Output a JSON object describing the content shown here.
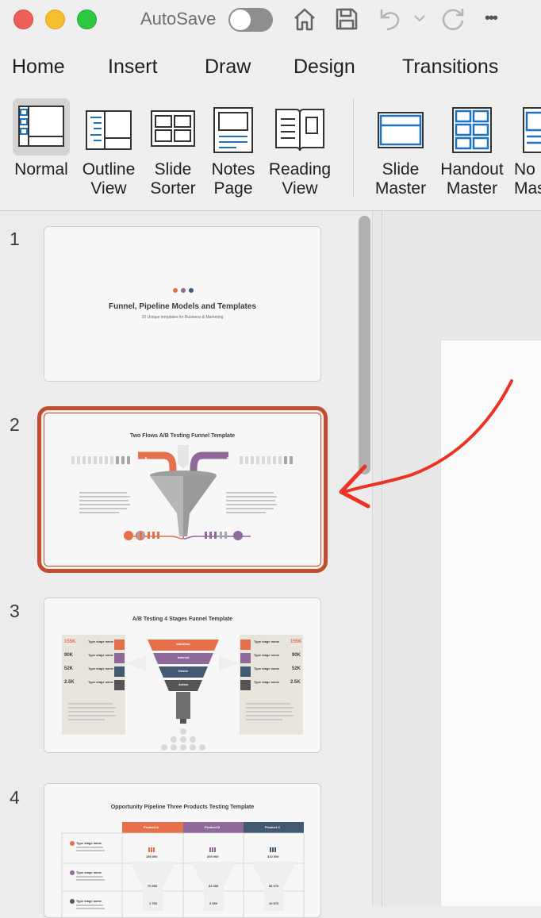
{
  "titlebar": {
    "autosave_label": "AutoSave",
    "more_label": "•••"
  },
  "tabs": [
    "Home",
    "Insert",
    "Draw",
    "Design",
    "Transitions"
  ],
  "ribbon": {
    "normal": "Normal",
    "outline": "Outline\nView",
    "sorter": "Slide\nSorter",
    "notes": "Notes\nPage",
    "reading": "Reading\nView",
    "slide_master": "Slide\nMaster",
    "handout_master": "Handout\nMaster",
    "notes_master": "No\nMas"
  },
  "slides": [
    {
      "number": "1",
      "title": "Funnel, Pipeline Models and Templates",
      "subtitle": "20 Unique templates for Business & Marketing"
    },
    {
      "number": "2",
      "title": "Two Flows A/B Testing Funnel Template",
      "label_a": "A",
      "label_b": "B"
    },
    {
      "number": "3",
      "title": "A/B Testing 4 Stages Funnel Template",
      "left_values": [
        "155K",
        "90K",
        "52K",
        "2.5K"
      ],
      "right_values": [
        "155K",
        "90K",
        "52K",
        "2.5K"
      ],
      "stage_name": "Type stage name",
      "funnel_stages": [
        "Attention",
        "Interest",
        "Desire",
        "Action"
      ]
    },
    {
      "number": "4",
      "title": "Opportunity Pipeline Three Products Testing Template",
      "products": [
        "Product A",
        "Product B",
        "Product C"
      ],
      "stage_name": "Type stage name",
      "row1": [
        "155 000",
        "209 900",
        "310 000"
      ],
      "row2": [
        "70 900",
        "81 000",
        "86 070"
      ],
      "row3": [
        "1 750",
        "3 390",
        "10 870"
      ]
    }
  ],
  "colors": {
    "accent": "#c14e2e",
    "orange": "#e5704b",
    "purple": "#8e6a9b",
    "navy": "#415a72",
    "icon_blue": "#1e73be",
    "annotation_red": "#ea3323"
  }
}
